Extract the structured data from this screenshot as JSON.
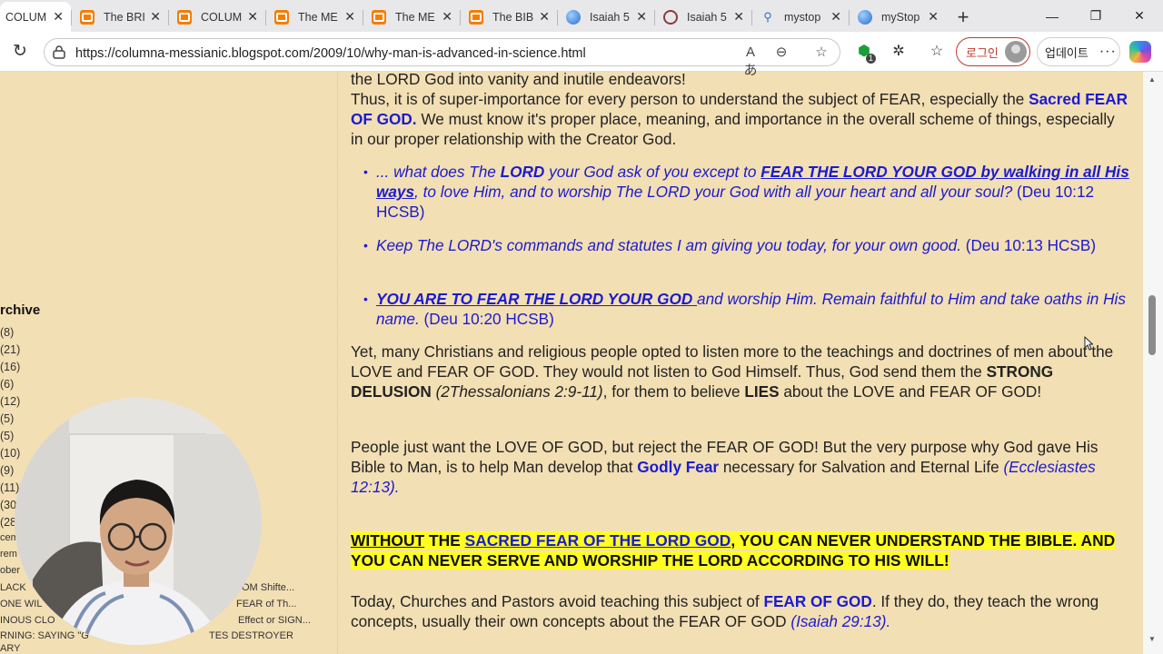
{
  "browser": {
    "tabs": [
      {
        "label": "COLUM",
        "icon": "blogger-icon",
        "active": true
      },
      {
        "label": "The BRI",
        "icon": "blogger-icon"
      },
      {
        "label": "COLUM",
        "icon": "blogger-icon"
      },
      {
        "label": "The ME",
        "icon": "blogger-icon"
      },
      {
        "label": "The ME",
        "icon": "blogger-icon"
      },
      {
        "label": "The BIB",
        "icon": "blogger-icon"
      },
      {
        "label": "Isaiah 5",
        "icon": "globe-icon"
      },
      {
        "label": "Isaiah 5",
        "icon": "ring-icon"
      },
      {
        "label": "mystop",
        "icon": "search-icon"
      },
      {
        "label": "myStop",
        "icon": "globe-icon"
      }
    ],
    "url": "https://columna-messianic.blogspot.com/2009/10/why-man-is-advanced-in-science.html",
    "login_label": "로그인",
    "update_label": "업데이트",
    "extension_badge": "1"
  },
  "sidebar": {
    "archive_title": "rchive",
    "counts": [
      "(8)",
      "(21)",
      "(16)",
      "(6)",
      "(12)",
      "(5)",
      "(5)",
      "(10)",
      "(9)",
      "(11)",
      "(30",
      "(28"
    ],
    "partial_links": [
      "cem",
      "rem",
      "ober",
      "LACK",
      "ONE WIL",
      "INOUS CLO",
      "RNING: SAYING \"G",
      "ARY",
      "OM Shifte...",
      "FEAR of Th...",
      "Effect or SIGN...",
      "TES DESTROYER"
    ]
  },
  "article": {
    "line_top": "the LORD God into vanity and inutile endeavors!",
    "p1_a": "Thus, it is of super-importance for every person to understand the subject of FEAR, especially the ",
    "p1_b": "Sacred FEAR OF GOD.",
    "p1_c": " We must know it's proper place, meaning, and importance in the overall scheme of things, especially in our proper relationship with the Creator God.",
    "b1_a": "... what does The ",
    "b1_b": "LORD",
    "b1_c": " your God ask of you except to ",
    "b1_d": "FEAR THE LORD YOUR GOD by walking in all His ways",
    "b1_e": ", to love Him, and to worship The LORD your God with all your heart and all your soul?",
    "b1_ref": "  (Deu 10:12 HCSB)",
    "b2_a": "Keep The LORD's commands and statutes I am giving you today, for your own good.",
    "b2_ref": "  (Deu 10:13 HCSB)",
    "b3_a": "YOU ARE TO FEAR THE LORD YOUR GOD ",
    "b3_b": "and worship Him. Remain faithful to Him and take oaths in His name.",
    "b3_ref": "  (Deu 10:20 HCSB)",
    "p2_a": "Yet, many Christians and religious people opted to listen more to the teachings and doctrines of men about the LOVE and FEAR OF GOD. They would not listen to God Himself. Thus, God send them the ",
    "p2_b": "STRONG DELUSION",
    "p2_c": " (2Thessalonians 2:9-11)",
    "p2_d": ", for them to believe ",
    "p2_e": "LIES",
    "p2_f": " about the LOVE and FEAR OF GOD!",
    "p3_a": "People just want the LOVE OF GOD, but reject the FEAR OF GOD! But the very purpose why God gave His Bible to Man, is to help Man develop that ",
    "p3_b": "Godly Fear",
    "p3_c": " necessary for Salvation and Eternal Life ",
    "p3_d": "(Ecclesiastes 12:13).",
    "hl_a": "WITHOUT",
    "hl_b": " THE ",
    "hl_c": "SACRED FEAR OF THE LORD GOD",
    "hl_d": ", YOU CAN NEVER UNDERSTAND THE BIBLE. AND YOU CAN NEVER SERVE AND WORSHIP THE LORD ACCORDING TO HIS WILL!",
    "p4_a": "Today, Churches and Pastors avoid teaching this subject of ",
    "p4_b": "FEAR OF GOD",
    "p4_c": ". If they do, they teach the wrong concepts, usually their own concepts about the FEAR OF GOD ",
    "p4_d": "(Isaiah 29:13)."
  },
  "colors": {
    "page_bg": "#f3dfb4",
    "link_blue": "#1b1bd0",
    "highlight": "#ffff22"
  }
}
